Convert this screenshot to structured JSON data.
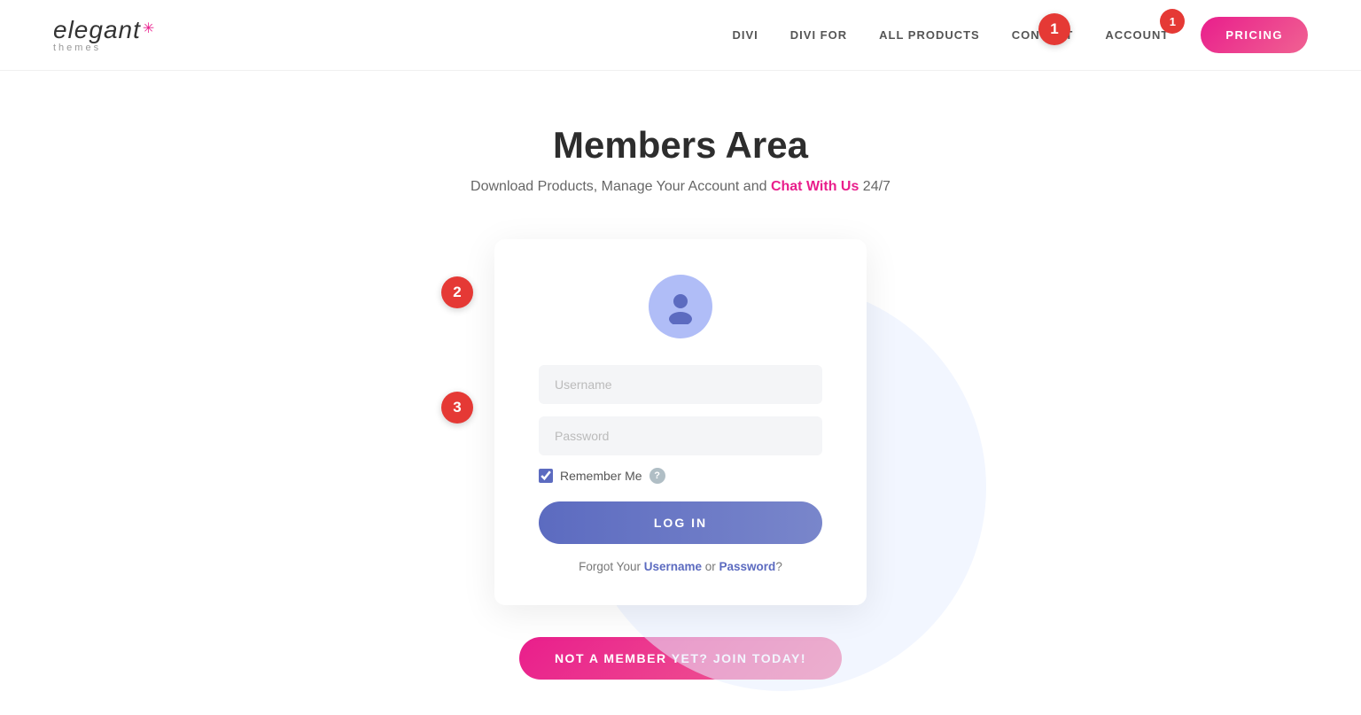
{
  "logo": {
    "main": "elegant",
    "star": "✳",
    "sub": "themes"
  },
  "nav": {
    "links": [
      "DIVI",
      "DIVI FOR",
      "ALL PRODUCTS",
      "CONTACT",
      "ACCOUNT"
    ],
    "account_badge": "1",
    "pricing_label": "PRICING"
  },
  "hero": {
    "title": "Members Area",
    "subtitle_prefix": "Download Products, Manage Your Account and ",
    "chat_link": "Chat With Us",
    "subtitle_suffix": " 24/7"
  },
  "login_card": {
    "username_placeholder": "Username",
    "password_placeholder": "Password",
    "remember_label": "Remember Me",
    "help_text": "?",
    "login_button": "LOG IN",
    "forgot_prefix": "Forgot Your ",
    "forgot_username": "Username",
    "forgot_or": " or ",
    "forgot_password": "Password",
    "forgot_suffix": "?"
  },
  "join_banner": {
    "label": "NOT A MEMBER YET? JOIN TODAY!"
  },
  "annotations": {
    "badge1": "1",
    "badge2": "2",
    "badge3": "3"
  }
}
